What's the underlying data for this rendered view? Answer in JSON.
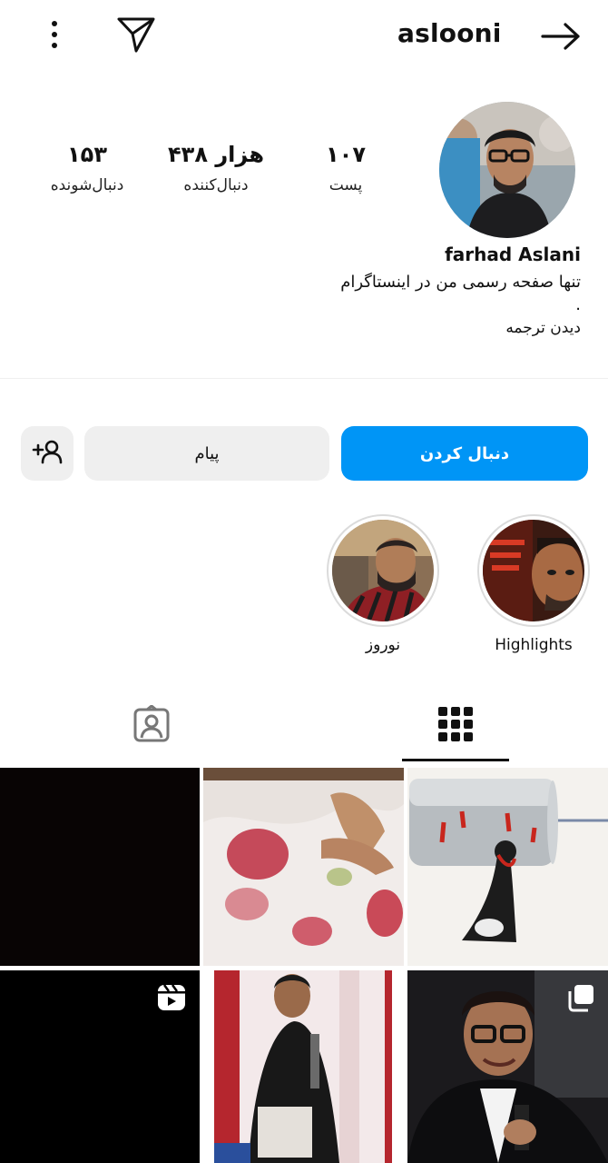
{
  "header": {
    "username": "aslooni"
  },
  "stats": {
    "posts": {
      "value": "۱۰۷",
      "label": "پست"
    },
    "followers": {
      "value": "۴۳۸ هزار",
      "label": "دنبال‌کننده"
    },
    "following": {
      "value": "۱۵۳",
      "label": "دنبال‌شونده"
    }
  },
  "bio": {
    "name": "farhad Aslani",
    "line1": "تنها صفحه رسمی من در اینستاگرام",
    "line2": ".",
    "translate": "دیدن ترجمه"
  },
  "actions": {
    "follow_label": "دنبال کردن",
    "message_label": "پیام"
  },
  "highlights": [
    {
      "label": "Highlights"
    },
    {
      "label": "نوروز"
    }
  ],
  "colors": {
    "accent": "#0095f6",
    "secondary_button": "#efefef"
  },
  "icons": {
    "more": "more-vertical-icon",
    "direct": "paper-plane-icon",
    "back": "arrow-right-icon",
    "add_user": "add-user-icon",
    "grid": "grid-icon",
    "tagged": "tagged-person-icon",
    "reel": "reel-icon",
    "carousel": "carousel-icon"
  }
}
